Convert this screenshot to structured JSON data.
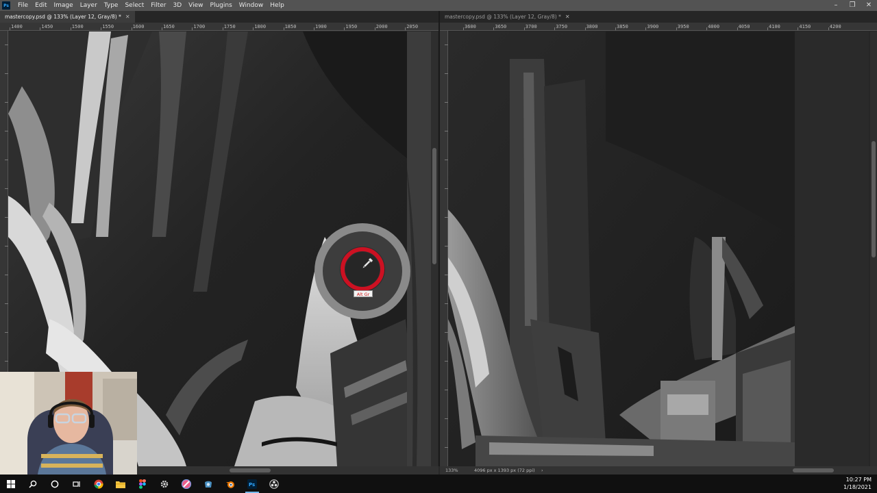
{
  "app": {
    "logo_text": "Ps",
    "menu": [
      "File",
      "Edit",
      "Image",
      "Layer",
      "Type",
      "Select",
      "Filter",
      "3D",
      "View",
      "Plugins",
      "Window",
      "Help"
    ],
    "window_controls": [
      "minimize",
      "restore",
      "close"
    ]
  },
  "documents": {
    "left": {
      "tab_title": "mastercopy.psd @ 133% (Layer 12, Gray/8) *",
      "ruler_h": [
        "1400",
        "1450",
        "1500",
        "1550",
        "1600",
        "1650",
        "1700",
        "1750",
        "1800",
        "1850",
        "1900",
        "1950",
        "2000",
        "2050"
      ],
      "status": {
        "zoom": "",
        "doc_size": ""
      }
    },
    "right": {
      "tab_title": "mastercopy.psd @ 133% (Layer 12, Gray/8) *",
      "ruler_h": [
        "3600",
        "3650",
        "3700",
        "3750",
        "3800",
        "3850",
        "3900",
        "3950",
        "4000",
        "4050",
        "4100",
        "4150",
        "4200"
      ],
      "status": {
        "zoom": "133%",
        "doc_size": "4096 px x 1393 px (72 ppi)"
      }
    }
  },
  "color_picker": {
    "label": "Alt Gr",
    "sample_color": "#cc1122",
    "ring_outer": "#8a8a8a",
    "ring_inner": "#3d3d3d"
  },
  "taskbar": {
    "icons": [
      "windows-start-icon",
      "search-icon",
      "cortana-icon",
      "task-view-icon",
      "chrome-icon",
      "file-explorer-icon",
      "figma-icon",
      "settings-icon",
      "krita-icon",
      "app-icon",
      "blender-icon",
      "photoshop-icon",
      "obs-icon"
    ],
    "time": "10:27 PM",
    "date": "1/18/2021"
  },
  "colors": {
    "menubar": "#535353",
    "canvas_bg": "#262626",
    "accent": "#31a8ff"
  }
}
